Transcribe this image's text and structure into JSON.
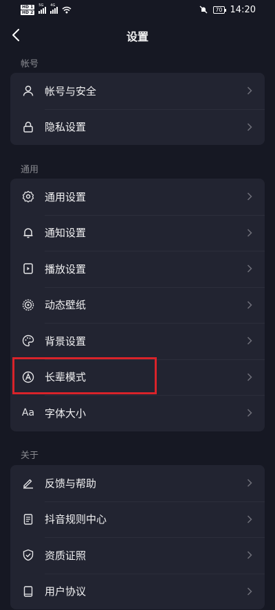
{
  "status_bar": {
    "hd1": "HD 1",
    "hd2": "HD 2",
    "net1": "5G",
    "net2": "4G",
    "battery": "70",
    "time": "14:20"
  },
  "header": {
    "title": "设置"
  },
  "sections": {
    "account": {
      "label": "帐号",
      "items": [
        {
          "label": "帐号与安全",
          "icon": "user-icon"
        },
        {
          "label": "隐私设置",
          "icon": "lock-icon"
        }
      ]
    },
    "general": {
      "label": "通用",
      "items": [
        {
          "label": "通用设置",
          "icon": "gear-icon"
        },
        {
          "label": "通知设置",
          "icon": "bell-icon"
        },
        {
          "label": "播放设置",
          "icon": "play-icon"
        },
        {
          "label": "动态壁纸",
          "icon": "wallpaper-icon"
        },
        {
          "label": "背景设置",
          "icon": "palette-icon"
        },
        {
          "label": "长辈模式",
          "icon": "elder-mode-icon"
        },
        {
          "label": "字体大小",
          "icon": "font-size-icon",
          "icon_text": "Aa"
        }
      ]
    },
    "about": {
      "label": "关于",
      "items": [
        {
          "label": "反馈与帮助",
          "icon": "edit-icon"
        },
        {
          "label": "抖音规则中心",
          "icon": "rules-icon"
        },
        {
          "label": "资质证照",
          "icon": "shield-check-icon"
        },
        {
          "label": "用户协议",
          "icon": "book-icon"
        }
      ]
    }
  },
  "colors": {
    "background": "#161823",
    "card": "#222431",
    "highlight": "#d9232a",
    "section_label": "#8a8b91"
  }
}
